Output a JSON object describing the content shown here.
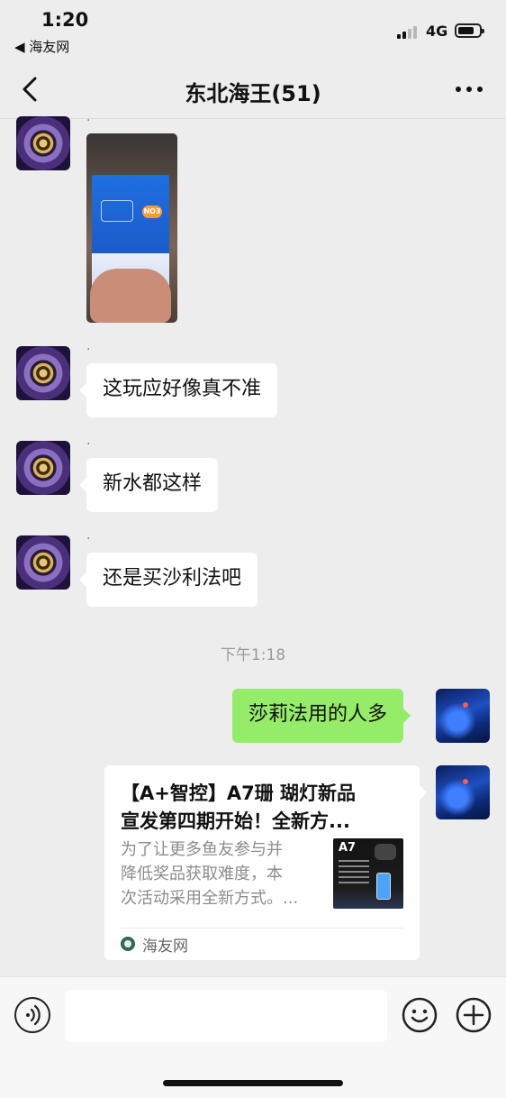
{
  "status_bar": {
    "time": "1:20",
    "back_app": "◀ 海友网",
    "network": "4G"
  },
  "nav": {
    "title": "东北海王(51)"
  },
  "messages": [
    {
      "sender_name": "·",
      "type": "image"
    },
    {
      "sender_name": "·",
      "type": "text",
      "text": "这玩应好像真不准"
    },
    {
      "sender_name": "·",
      "type": "text",
      "text": "新水都这样"
    },
    {
      "sender_name": "·",
      "type": "text",
      "text": "还是买沙利法吧"
    }
  ],
  "photo_label": "NO3",
  "timestamp": "下午1:18",
  "my_messages": [
    {
      "type": "text",
      "text": "莎莉法用的人多"
    },
    {
      "type": "link_card",
      "title_line1": "【A+智控】A7珊 瑚灯新品",
      "title_line2": "宣发第四期开始！全新方...",
      "desc_line1": "为了让更多鱼友参与并",
      "desc_line2": "降低奖品获取难度，本",
      "desc_line3": "次活动采用全新方式。...",
      "thumb_text": "A7",
      "source": "海友网"
    }
  ],
  "input": {
    "value": "",
    "placeholder": ""
  },
  "icons": {
    "voice": "voice-icon",
    "emoji": "emoji-icon",
    "plus": "plus-icon"
  },
  "colors": {
    "my_bubble": "#95ec69",
    "background": "#ededed"
  }
}
